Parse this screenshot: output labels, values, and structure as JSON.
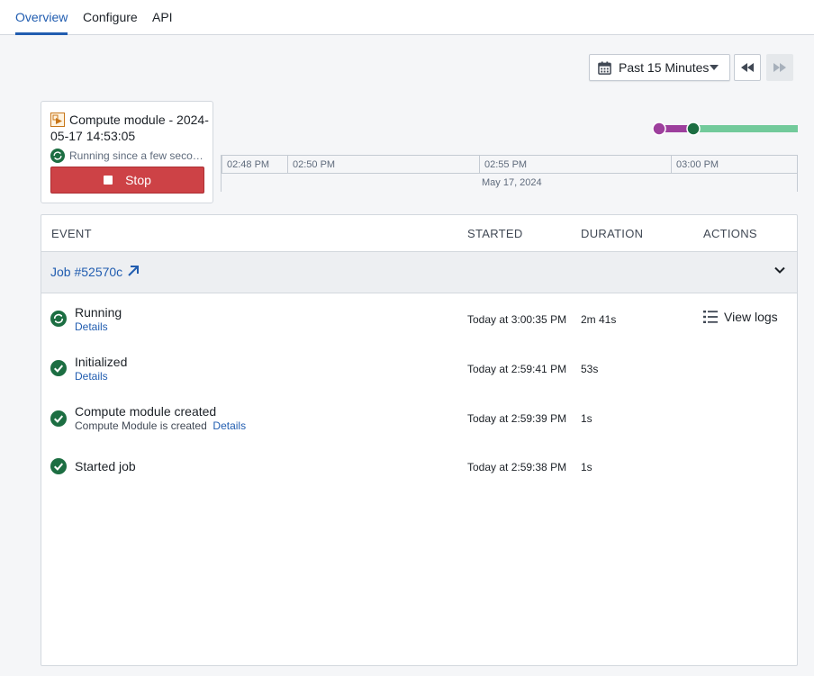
{
  "tabs": [
    {
      "label": "Overview",
      "active": true
    },
    {
      "label": "Configure",
      "active": false
    },
    {
      "label": "API",
      "active": false
    }
  ],
  "time_range": {
    "selected": "Past 15 Minutes",
    "icon": "calendar-icon"
  },
  "module": {
    "title": "Compute module - 2024-05-17 14:53:05",
    "status_text": "Running since a few seconds ago",
    "stop_label": "Stop"
  },
  "timeline": {
    "ticks": [
      "02:48 PM",
      "02:50 PM",
      "02:55 PM",
      "03:00 PM"
    ],
    "date": "May 17, 2024",
    "colors": {
      "initializing": "#9d3f9d",
      "running": "#72ca9b",
      "marker": "#1c6e42"
    }
  },
  "events_table": {
    "columns": {
      "event": "EVENT",
      "started": "STARTED",
      "duration": "DURATION",
      "actions": "ACTIONS"
    },
    "job": {
      "label": "Job #52570c"
    },
    "rows": [
      {
        "title": "Running",
        "sub_text": "",
        "details": "Details",
        "started": "Today at 3:00:35 PM",
        "duration": "2m 41s",
        "action": "View logs",
        "status": "running"
      },
      {
        "title": "Initialized",
        "sub_text": "",
        "details": "Details",
        "started": "Today at 2:59:41 PM",
        "duration": "53s",
        "action": "",
        "status": "success"
      },
      {
        "title": "Compute module created",
        "sub_text": "Compute Module is created",
        "details": "Details",
        "started": "Today at 2:59:39 PM",
        "duration": "1s",
        "action": "",
        "status": "success"
      },
      {
        "title": "Started job",
        "sub_text": "",
        "details": "",
        "started": "Today at 2:59:38 PM",
        "duration": "1s",
        "action": "",
        "status": "success"
      }
    ]
  },
  "colors": {
    "accent": "#215db0",
    "danger": "#cd4246",
    "success": "#1c6e42"
  }
}
